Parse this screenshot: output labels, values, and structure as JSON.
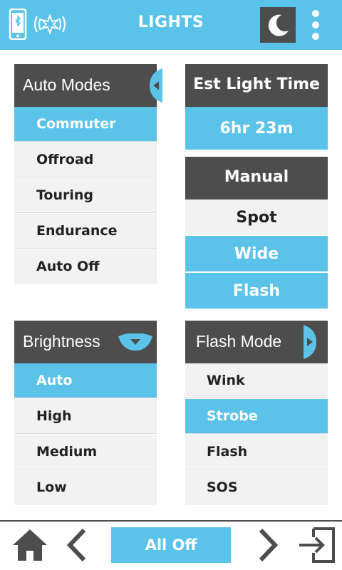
{
  "header": {
    "title": "LIGHTS",
    "icons": [
      "bluetooth-phone-icon",
      "light-signal-icon",
      "night-mode-icon",
      "more-vertical-icon"
    ],
    "accent": "#5bc3ea",
    "dark": "#4d4d4d"
  },
  "auto_modes": {
    "title": "Auto Modes",
    "items": [
      "Commuter",
      "Offroad",
      "Touring",
      "Endurance",
      "Auto Off"
    ],
    "selected": "Commuter"
  },
  "est_light_time": {
    "title": "Est Light Time",
    "value": "6hr 23m"
  },
  "manual": {
    "title": "Manual",
    "items": [
      "Spot",
      "Wide",
      "Flash"
    ],
    "selected": [
      "Wide",
      "Flash"
    ]
  },
  "brightness": {
    "title": "Brightness",
    "items": [
      "Auto",
      "High",
      "Medium",
      "Low"
    ],
    "selected": "Auto"
  },
  "flash_mode": {
    "title": "Flash Mode",
    "items": [
      "Wink",
      "Strobe",
      "Flash",
      "SOS"
    ],
    "selected": "Strobe"
  },
  "bottom_bar": {
    "all_off_label": "All Off",
    "icons": [
      "home-icon",
      "back-icon",
      "forward-icon",
      "exit-icon"
    ]
  }
}
